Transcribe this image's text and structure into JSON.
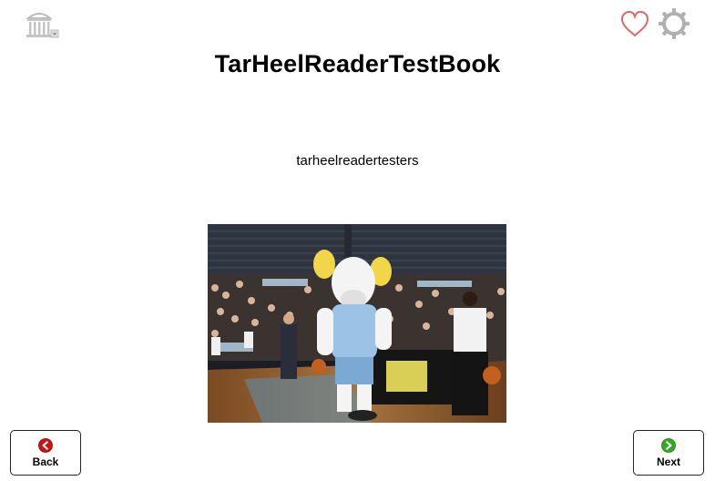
{
  "book": {
    "title": "TarHeelReaderTestBook",
    "author": "tarheelreadertesters"
  },
  "nav": {
    "back_label": "Back",
    "next_label": "Next"
  },
  "colors": {
    "favorite_heart": "#e06666",
    "gear": "#b0b0b0",
    "back_arrow": "#cc1111",
    "next_arrow": "#33aa22"
  },
  "icons": [
    "old-well-logo-icon",
    "heart-icon",
    "gear-icon",
    "back-arrow-icon",
    "next-arrow-icon"
  ]
}
